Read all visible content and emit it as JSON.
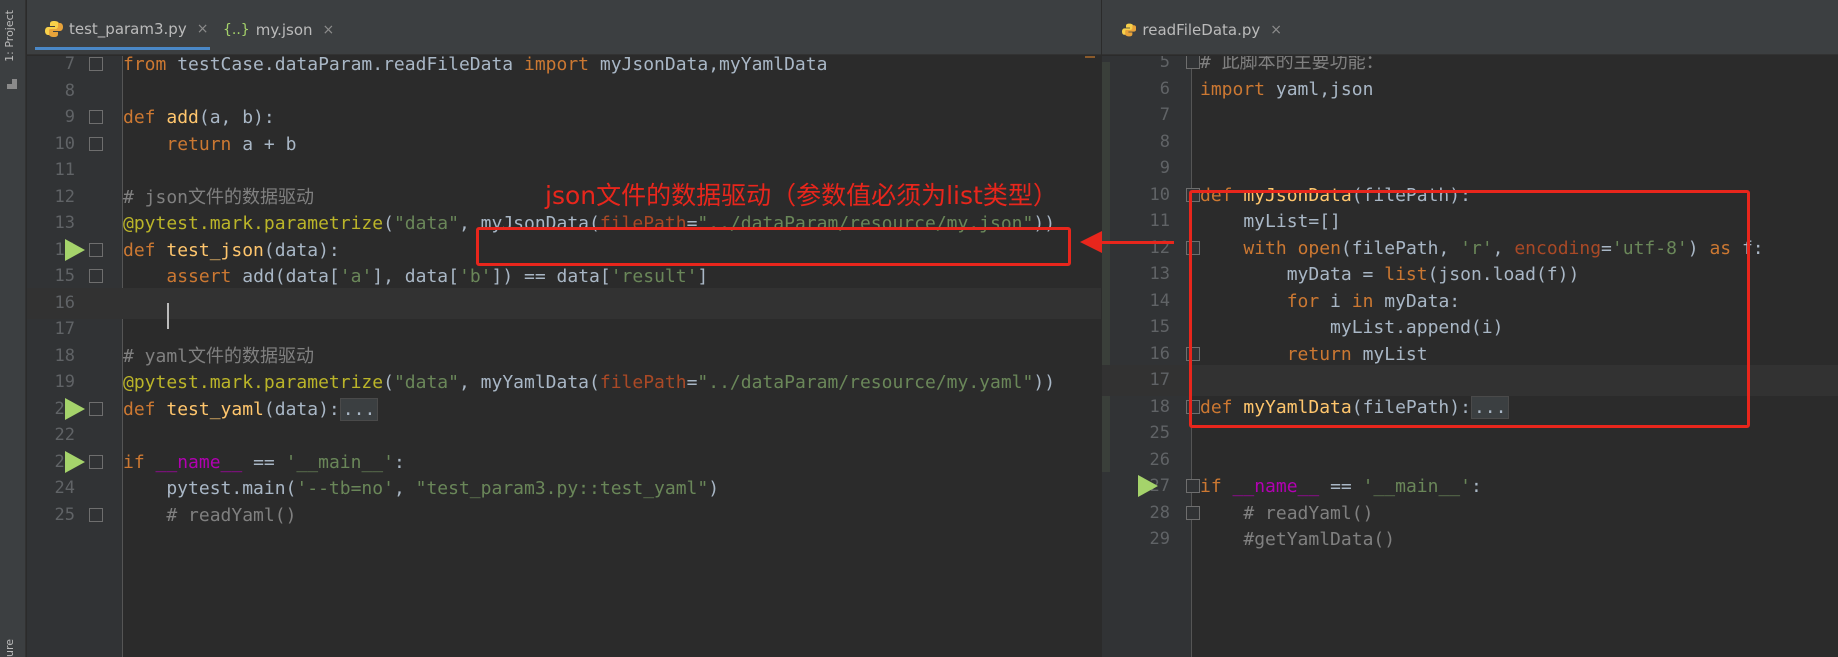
{
  "sidebar": {
    "project_label": "1: Project",
    "bottom_label": "ure"
  },
  "left_tabs": [
    {
      "label": "test_param3.py",
      "icon": "python-file-icon",
      "close": "×"
    },
    {
      "label": "my.json",
      "icon": "json-file-icon",
      "close": "×"
    }
  ],
  "right_tabs": [
    {
      "label": "readFileData.py",
      "icon": "python-file-icon",
      "close": "×"
    }
  ],
  "left_editor": {
    "lines": [
      {
        "n": "7",
        "t": "from testCase.dataParam.readFileData import myJsonData,myYamlData"
      },
      {
        "n": "8",
        "t": ""
      },
      {
        "n": "9",
        "t": "def add(a, b):"
      },
      {
        "n": "10",
        "t": "    return a + b"
      },
      {
        "n": "11",
        "t": ""
      },
      {
        "n": "12",
        "t": "# json文件的数据驱动"
      },
      {
        "n": "13",
        "t": "@pytest.mark.parametrize(\"data\", myJsonData(filePath=\"../dataParam/resource/my.json\"))"
      },
      {
        "n": "14",
        "t": "def test_json(data):"
      },
      {
        "n": "15",
        "t": "    assert add(data['a'], data['b']) == data['result']"
      },
      {
        "n": "16",
        "t": ""
      },
      {
        "n": "17",
        "t": ""
      },
      {
        "n": "18",
        "t": "# yaml文件的数据驱动"
      },
      {
        "n": "19",
        "t": "@pytest.mark.parametrize(\"data\", myYamlData(filePath=\"../dataParam/resource/my.yaml\"))"
      },
      {
        "n": "20",
        "t": "def test_yaml(data):..."
      },
      {
        "n": "22",
        "t": ""
      },
      {
        "n": "23",
        "t": "if __name__ == '__main__':"
      },
      {
        "n": "24",
        "t": "    pytest.main('--tb=no', \"test_param3.py::test_yaml\")"
      },
      {
        "n": "25",
        "t": "    # readYaml()"
      }
    ]
  },
  "right_editor": {
    "lines": [
      {
        "n": "5",
        "t": "# 此脚本的主要功能："
      },
      {
        "n": "6",
        "t": "import yaml,json"
      },
      {
        "n": "7",
        "t": ""
      },
      {
        "n": "8",
        "t": ""
      },
      {
        "n": "9",
        "t": ""
      },
      {
        "n": "10",
        "t": "def myJsonData(filePath):"
      },
      {
        "n": "11",
        "t": "    myList=[]"
      },
      {
        "n": "12",
        "t": "    with open(filePath, 'r', encoding='utf-8') as f:"
      },
      {
        "n": "13",
        "t": "        myData = list(json.load(f))"
      },
      {
        "n": "14",
        "t": "        for i in myData:"
      },
      {
        "n": "15",
        "t": "            myList.append(i)"
      },
      {
        "n": "16",
        "t": "        return myList"
      },
      {
        "n": "17",
        "t": ""
      },
      {
        "n": "18",
        "t": "def myYamlData(filePath):..."
      },
      {
        "n": "25",
        "t": ""
      },
      {
        "n": "26",
        "t": ""
      },
      {
        "n": "27",
        "t": "if __name__ == '__main__':"
      },
      {
        "n": "28",
        "t": "    # readYaml()"
      },
      {
        "n": "29",
        "t": "    #getYamlData()"
      }
    ]
  },
  "annotation": {
    "text": "json文件的数据驱动（参数值必须为list类型）",
    "color": "#e8261c"
  },
  "colors": {
    "keyword": "#cc7832",
    "string": "#6a8759",
    "function": "#ffc66d",
    "decorator": "#bbb529",
    "comment": "#808080",
    "run_gutter": "#a5d36b"
  }
}
